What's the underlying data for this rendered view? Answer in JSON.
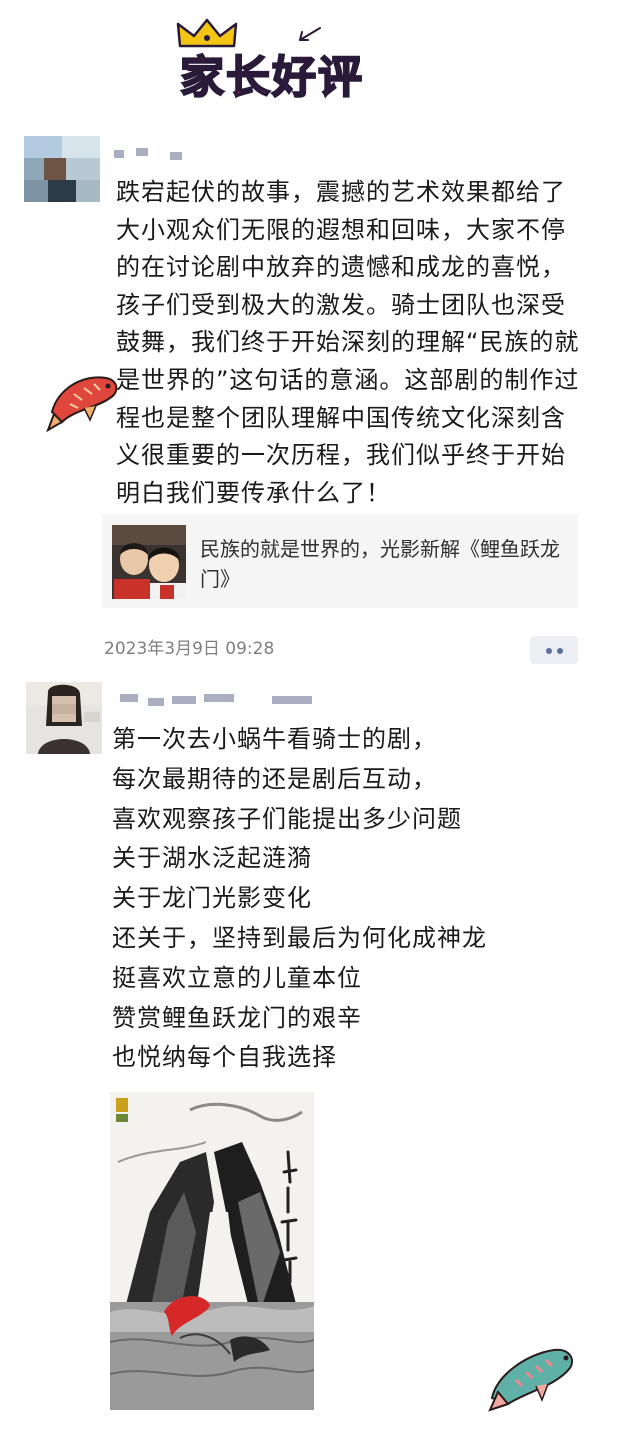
{
  "header": {
    "title_part1": "家长",
    "title_part2": "好评"
  },
  "post1": {
    "lines": [
      "跌宕起伏的故事，震撼的艺术效果都给了",
      "大小观众们无限的遐想和回味，大家不停",
      "的在讨论剧中放弃的遗憾和成龙的喜悦，",
      "孩子们受到极大的激发。骑士团队也深受",
      "鼓舞，我们终于开始深刻的理解“民族的就",
      "是世界的”这句话的意涵。这部剧的制作过",
      "程也是整个团队理解中国传统文化深刻含",
      "义很重要的一次历程，我们似乎终于开始",
      "明白我们要传承什么了！"
    ],
    "link_title_line1": "民族的就是世界的，光影新解《鲤鱼跃龙",
    "link_title_line2": "门》",
    "timestamp": "2023年3月9日 09:28"
  },
  "post2": {
    "lines": [
      "第一次去小蜗牛看骑士的剧，",
      "每次最期待的还是剧后互动，",
      "喜欢观察孩子们能提出多少问题",
      "关于湖水泛起涟漪",
      "关于龙门光影变化",
      "还关于，坚持到最后为何化成神龙",
      "挺喜欢立意的儿童本位",
      "赞赏鲤鱼跃龙门的艰辛",
      "也悦纳每个自我选择"
    ],
    "poster_title": "鲤鱼跃龙门"
  },
  "colors": {
    "title_pink": "#e8317a",
    "title_blue": "#4a6cf0",
    "crown_yellow": "#f5c514",
    "timestamp_gray": "#7f7f7f",
    "link_card_bg": "#f5f5f5",
    "koi_red": "#e0473c",
    "koi_teal": "#5fb0a6"
  },
  "icons": {
    "crown": "crown-icon",
    "arrow": "arrow-icon",
    "koi_left": "koi-fish-icon",
    "koi_right": "koi-fish-icon",
    "more": "more-dots-icon"
  }
}
